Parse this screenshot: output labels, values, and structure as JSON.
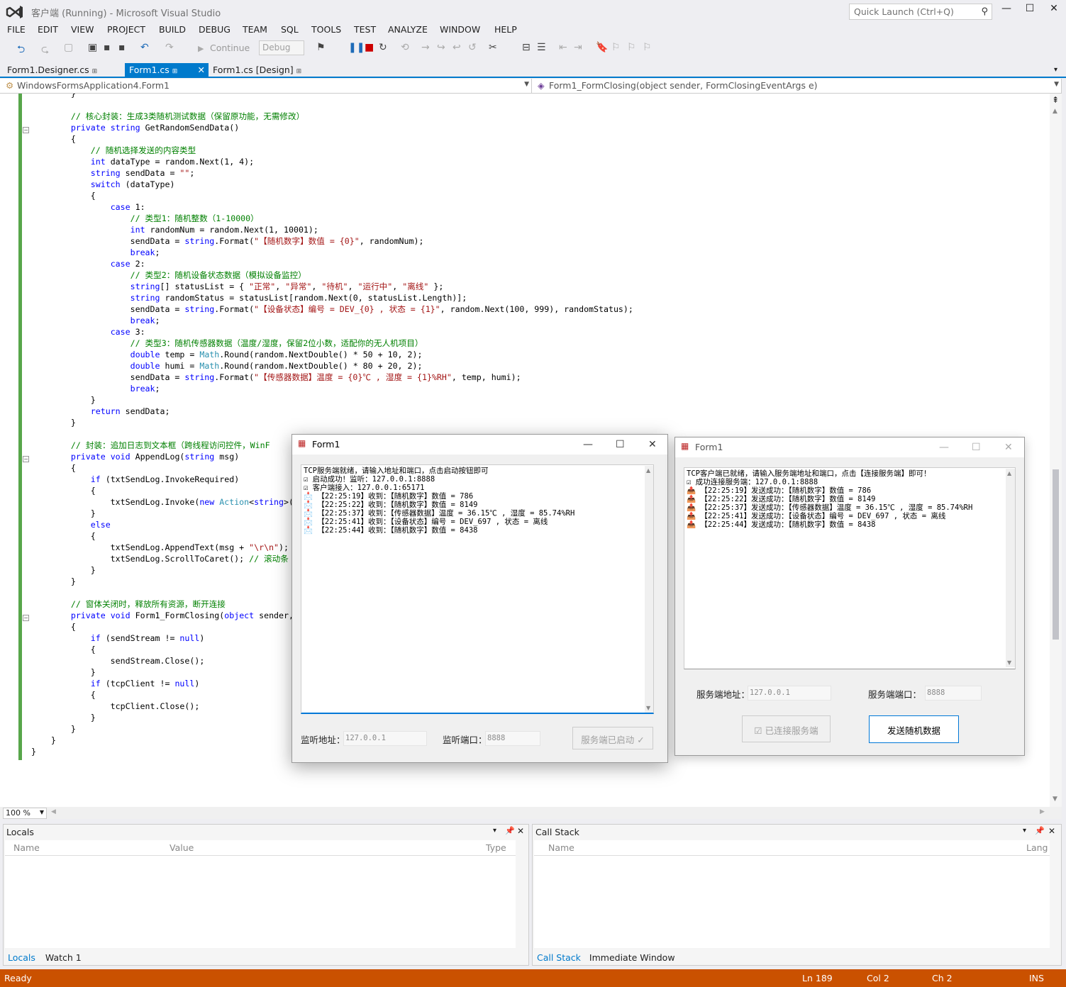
{
  "app": {
    "title": "客户端 (Running) - Microsoft Visual Studio",
    "quick_launch": "Quick Launch (Ctrl+Q)",
    "window_min": "—",
    "window_max": "☐",
    "window_close": "✕"
  },
  "menu": [
    "FILE",
    "EDIT",
    "VIEW",
    "PROJECT",
    "BUILD",
    "DEBUG",
    "TEAM",
    "SQL",
    "TOOLS",
    "TEST",
    "ANALYZE",
    "WINDOW",
    "HELP"
  ],
  "toolbar": {
    "continue_label": "Continue",
    "config": "Debug"
  },
  "tabs": [
    {
      "label": "Form1.Designer.cs",
      "pin": "⊞"
    },
    {
      "label": "Form1.cs",
      "pin": "⊞"
    },
    {
      "label": "Form1.cs [Design]",
      "pin": "⊞"
    }
  ],
  "nav": {
    "class_combo": "WindowsFormsApplication4.Form1",
    "member_combo": "Form1_FormClosing(object sender, FormClosingEventArgs e)"
  },
  "code_lines": [
    "        }",
    "",
    "        // 核心封装：生成3类随机测试数据（保留原功能，无需修改）",
    "        private string GetRandomSendData()",
    "        {",
    "            // 随机选择发送的内容类型",
    "            int dataType = random.Next(1, 4);",
    "            string sendData = \"\";",
    "            switch (dataType)",
    "            {",
    "                case 1:",
    "                    // 类型1：随机整数（1-10000）",
    "                    int randomNum = random.Next(1, 10001);",
    "                    sendData = string.Format(\"【随机数字】数值 = {0}\", randomNum);",
    "                    break;",
    "                case 2:",
    "                    // 类型2：随机设备状态数据（模拟设备监控）",
    "                    string[] statusList = { \"正常\", \"异常\", \"待机\", \"运行中\", \"离线\" };",
    "                    string randomStatus = statusList[random.Next(0, statusList.Length)];",
    "                    sendData = string.Format(\"【设备状态】编号 = DEV_{0} , 状态 = {1}\", random.Next(100, 999), randomStatus);",
    "                    break;",
    "                case 3:",
    "                    // 类型3：随机传感器数据（温度/湿度，保留2位小数，适配你的无人机项目）",
    "                    double temp = Math.Round(random.NextDouble() * 50 + 10, 2);",
    "                    double humi = Math.Round(random.NextDouble() * 80 + 20, 2);",
    "                    sendData = string.Format(\"【传感器数据】温度 = {0}℃ , 湿度 = {1}%RH\", temp, humi);",
    "                    break;",
    "            }",
    "            return sendData;",
    "        }",
    "",
    "        // 封装：追加日志到文本框（跨线程访问控件，WinF",
    "        private void AppendLog(string msg)",
    "        {",
    "            if (txtSendLog.InvokeRequired)",
    "            {",
    "                txtSendLog.Invoke(new Action<string>(",
    "            }",
    "            else",
    "            {",
    "                txtSendLog.AppendText(msg + \"\\r\\n\");",
    "                txtSendLog.ScrollToCaret(); // 滚动条",
    "            }",
    "        }",
    "",
    "        // 窗体关闭时，释放所有资源，断开连接",
    "        private void Form1_FormClosing(object sender,",
    "        {",
    "            if (sendStream != null)",
    "            {",
    "                sendStream.Close();",
    "            }",
    "            if (tcpClient != null)",
    "            {",
    "                tcpClient.Close();",
    "            }",
    "        }",
    "    }",
    "}"
  ],
  "zoom": "100 %",
  "locals": {
    "title": "Locals",
    "col_name": "Name",
    "col_value": "Value",
    "col_type": "Type",
    "tab_locals": "Locals",
    "tab_watch": "Watch 1"
  },
  "callstack": {
    "title": "Call Stack",
    "col_name": "Name",
    "col_lang": "Lang",
    "tab_callstack": "Call Stack",
    "tab_immediate": "Immediate Window"
  },
  "status": {
    "ready": "Ready",
    "ln": "Ln 189",
    "col": "Col 2",
    "ch": "Ch 2",
    "ins": "INS"
  },
  "server_form": {
    "title": "Form1",
    "log": [
      "TCP服务端就绪，请输入地址和端口，点击启动按钮即可",
      "☑ 启动成功！监听：127.0.0.1:8888",
      "☑ 客户端接入：127.0.0.1:65171",
      "📩 【22:25:19】收到：【随机数字】数值 = 786",
      "📩 【22:25:22】收到：【随机数字】数值 = 8149",
      "📩 【22:25:37】收到：【传感器数据】温度 = 36.15℃ , 湿度 = 85.74%RH",
      "📩 【22:25:41】收到：【设备状态】编号 = DEV_697 , 状态 = 离线",
      "📩 【22:25:44】收到：【随机数字】数值 = 8438"
    ],
    "addr_label": "监听地址：",
    "addr_value": "127.0.0.1",
    "port_label": "监听端口：",
    "port_value": "8888",
    "start_button": "服务端已启动 ✓"
  },
  "client_form": {
    "title": "Form1",
    "log": [
      "TCP客户端已就绪，请输入服务端地址和端口，点击【连接服务端】即可！",
      "☑ 成功连接服务端：127.0.0.1:8888",
      "📤 【22:25:19】发送成功：【随机数字】数值 = 786",
      "📤 【22:25:22】发送成功：【随机数字】数值 = 8149",
      "📤 【22:25:37】发送成功：【传感器数据】温度 = 36.15℃ , 湿度 = 85.74%RH",
      "📤 【22:25:41】发送成功：【设备状态】编号 = DEV_697 , 状态 = 离线",
      "📤 【22:25:44】发送成功：【随机数字】数值 = 8438"
    ],
    "addr_label": "服务端地址：",
    "addr_value": "127.0.0.1",
    "port_label": "服务端端口：",
    "port_value": "8888",
    "connect_button": "☑ 已连接服务端",
    "send_button": "发送随机数据"
  },
  "colors": {
    "accent": "#007acc",
    "status_bar": "#ca5100",
    "keyword": "#0000ff",
    "type": "#2b91af",
    "comment": "#008000",
    "string": "#a31515",
    "change_bar": "#57a64a"
  }
}
